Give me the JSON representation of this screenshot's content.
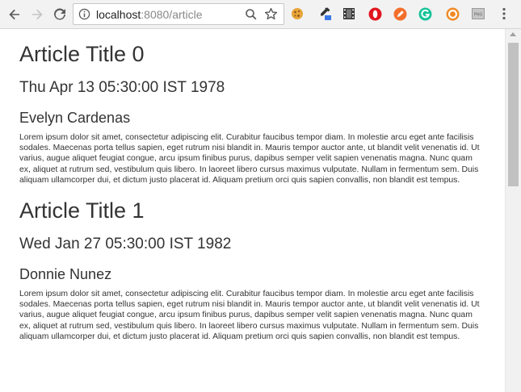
{
  "browser": {
    "url_host": "localhost",
    "url_rest": ":8080/article",
    "icons": {
      "back": "arrow-left-icon",
      "forward": "arrow-right-icon",
      "reload": "reload-icon",
      "info": "info-icon",
      "zoom": "zoom-icon",
      "bookmark": "star-icon"
    },
    "extensions": [
      "cookie-icon",
      "eyedropper-icon",
      "film-icon",
      "opera-icon",
      "pen-icon",
      "grammarly-icon",
      "lifebuoy-icon",
      "image-extension-icon",
      "menu-icon"
    ],
    "ext_badge": "PNG"
  },
  "articles": [
    {
      "title": "Article Title 0",
      "date": "Thu Apr 13 05:30:00 IST 1978",
      "author": "Evelyn Cardenas",
      "body": "Lorem ipsum dolor sit amet, consectetur adipiscing elit. Curabitur faucibus tempor diam. In molestie arcu eget ante facilisis sodales. Maecenas porta tellus sapien, eget rutrum nisi blandit in. Mauris tempor auctor ante, ut blandit velit venenatis id. Ut varius, augue aliquet feugiat congue, arcu ipsum finibus purus, dapibus semper velit sapien venenatis magna. Nunc quam ex, aliquet at rutrum sed, vestibulum quis libero. In laoreet libero cursus maximus vulputate. Nullam in fermentum sem. Duis aliquam ullamcorper dui, et dictum justo placerat id. Aliquam pretium orci quis sapien convallis, non blandit est tempus."
    },
    {
      "title": "Article Title 1",
      "date": "Wed Jan 27 05:30:00 IST 1982",
      "author": "Donnie Nunez",
      "body": "Lorem ipsum dolor sit amet, consectetur adipiscing elit. Curabitur faucibus tempor diam. In molestie arcu eget ante facilisis sodales. Maecenas porta tellus sapien, eget rutrum nisi blandit in. Mauris tempor auctor ante, ut blandit velit venenatis id. Ut varius, augue aliquet feugiat congue, arcu ipsum finibus purus, dapibus semper velit sapien venenatis magna. Nunc quam ex, aliquet at rutrum sed, vestibulum quis libero. In laoreet libero cursus maximus vulputate. Nullam in fermentum sem. Duis aliquam ullamcorper dui, et dictum justo placerat id. Aliquam pretium orci quis sapien convallis, non blandit est tempus."
    }
  ]
}
